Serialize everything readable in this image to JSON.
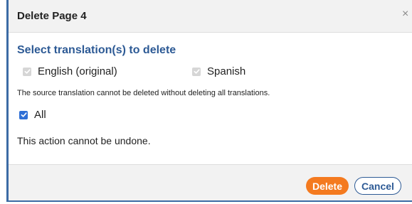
{
  "dialog": {
    "title": "Delete Page 4",
    "close_label": "×",
    "heading": "Select translation(s) to delete",
    "options": [
      {
        "label": "English (original)",
        "checked": true,
        "disabled": true
      },
      {
        "label": "Spanish",
        "checked": true,
        "disabled": true
      }
    ],
    "note": "The source translation cannot be deleted without deleting all translations.",
    "all_option": {
      "label": "All",
      "checked": true
    },
    "warning": "This action cannot be undone.",
    "buttons": {
      "delete_label": "Delete",
      "cancel_label": "Cancel"
    }
  },
  "colors": {
    "accent_blue": "#2d5a95",
    "delete_orange": "#f47a1f",
    "checkbox_blue": "#2f6fd6",
    "frame_blue": "#3c6ba5"
  }
}
